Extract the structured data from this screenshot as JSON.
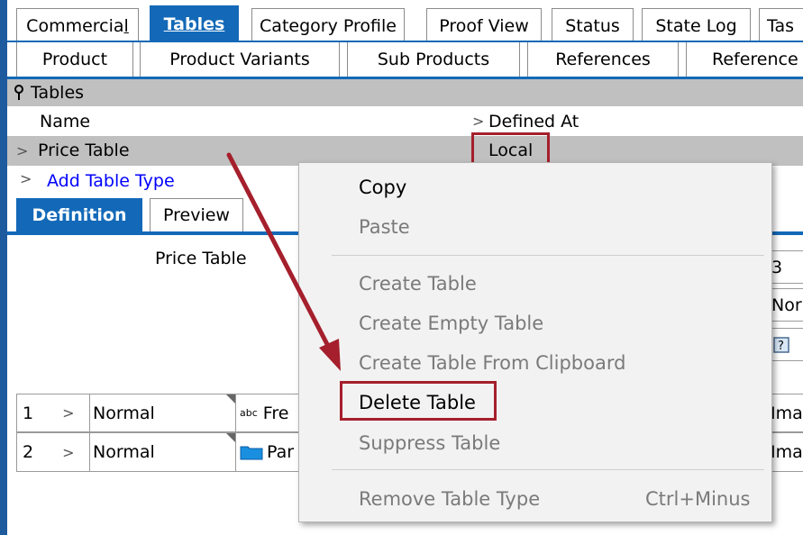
{
  "tabs_row1": [
    "Commercial",
    "Tables",
    "Category Profile",
    "Proof View",
    "Status",
    "State Log",
    "Tas"
  ],
  "tabs_row1_underline": [
    "l",
    "T",
    "C",
    "P",
    "S",
    "L",
    ""
  ],
  "tabs_row2": [
    "Product",
    "Product Variants",
    "Sub Products",
    "References",
    "Reference"
  ],
  "tables_section": {
    "title": "Tables",
    "col_name": "Name",
    "col_defined_at": "Defined At",
    "row_name": "Price Table",
    "row_defined_at": "Local",
    "add_link": "Add Table Type"
  },
  "detail_tabs": [
    "Definition",
    "Preview"
  ],
  "definition": {
    "title": "Price Table",
    "right_cells": [
      "3",
      "Norr"
    ],
    "rows": [
      {
        "num": "1",
        "type": "Normal",
        "field": "Fre",
        "right": "Imag"
      },
      {
        "num": "2",
        "type": "Normal",
        "field": "Par",
        "right": "Imag"
      }
    ]
  },
  "context_menu": {
    "copy": "Copy",
    "paste": "Paste",
    "create_table": "Create Table",
    "create_empty": "Create Empty Table",
    "create_clipboard": "Create Table From Clipboard",
    "delete_table": "Delete Table",
    "suppress_table": "Suppress Table",
    "remove_type": "Remove Table Type",
    "remove_shortcut": "Ctrl+Minus"
  },
  "colors": {
    "accent": "#1369b8",
    "highlight": "#a51f2c",
    "row_gray": "#c0c0c0",
    "link": "#0000ff"
  }
}
